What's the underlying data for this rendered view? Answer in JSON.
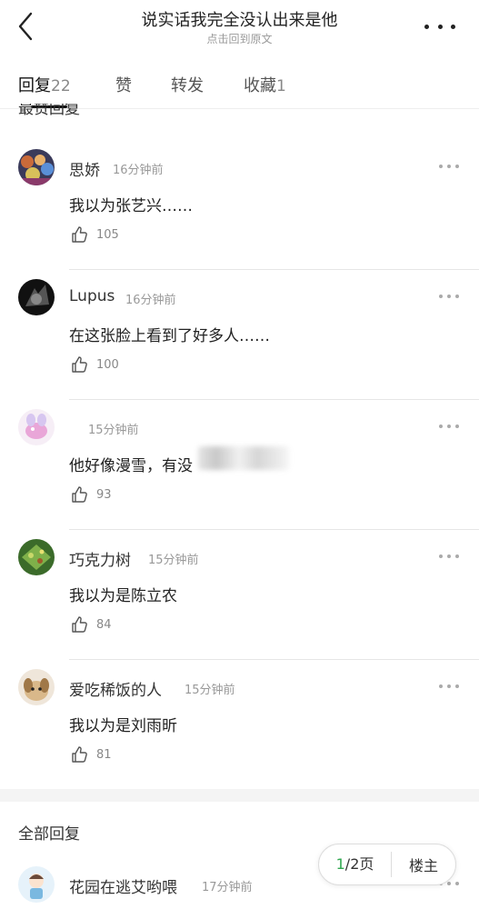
{
  "header": {
    "title": "说实话我完全没认出来是他",
    "subtitle": "点击回到原文"
  },
  "tabs": [
    {
      "label": "回复",
      "count": "22"
    },
    {
      "label": "赞",
      "count": ""
    },
    {
      "label": "转发",
      "count": ""
    },
    {
      "label": "收藏",
      "count": "1"
    }
  ],
  "sections": {
    "top": "最赞回复",
    "all": "全部回复"
  },
  "comments": [
    {
      "name": "思娇",
      "time": "16分钟前",
      "text": "我以为张艺兴……",
      "likes": "105"
    },
    {
      "name": "Lupus",
      "time": "16分钟前",
      "text": "在这张脸上看到了好多人……",
      "likes": "100"
    },
    {
      "name": "",
      "time": "15分钟前",
      "text": "他好像漫雪，有没",
      "likes": "93"
    },
    {
      "name": "巧克力树",
      "time": "15分钟前",
      "text": "我以为是陈立农",
      "likes": "84"
    },
    {
      "name": "爱吃稀饭的人",
      "time": "15分钟前",
      "text": "我以为是刘雨昕",
      "likes": "81"
    }
  ],
  "all_first": {
    "name": "花园在逃艾哟喂",
    "time": "17分钟前"
  },
  "pager": {
    "current": "1",
    "total": "/2页",
    "host_label": "楼主"
  },
  "colors": {
    "accent": "#2fa84f",
    "divider": "#e6e6e6"
  }
}
